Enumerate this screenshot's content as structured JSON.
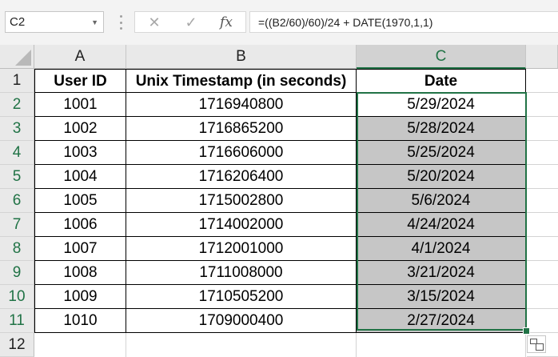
{
  "name_box": {
    "value": "C2"
  },
  "formula_bar": {
    "cancel_glyph": "✕",
    "enter_glyph": "✓",
    "fx_glyph": "fx",
    "formula": "=((B2/60)/60)/24 + DATE(1970,1,1)"
  },
  "columns": [
    "A",
    "B",
    "C"
  ],
  "selected_column": "C",
  "rows": [
    "1",
    "2",
    "3",
    "4",
    "5",
    "6",
    "7",
    "8",
    "9",
    "10",
    "11",
    "12"
  ],
  "table": {
    "headers": [
      "User ID",
      "Unix Timestamp (in seconds)",
      "Date"
    ],
    "data": [
      [
        "1001",
        "1716940800",
        "5/29/2024"
      ],
      [
        "1002",
        "1716865200",
        "5/28/2024"
      ],
      [
        "1003",
        "1716606000",
        "5/25/2024"
      ],
      [
        "1004",
        "1716206400",
        "5/20/2024"
      ],
      [
        "1005",
        "1715002800",
        "5/6/2024"
      ],
      [
        "1006",
        "1714002000",
        "4/24/2024"
      ],
      [
        "1007",
        "1712001000",
        "4/1/2024"
      ],
      [
        "1008",
        "1711008000",
        "3/21/2024"
      ],
      [
        "1009",
        "1710505200",
        "3/15/2024"
      ],
      [
        "1010",
        "1709000400",
        "2/27/2024"
      ]
    ]
  },
  "colors": {
    "accent": "#217346",
    "selection_fill": "#c6c6c6",
    "header_bg": "#e9e9e9"
  },
  "icons": {
    "name_box_dropdown": "chevron-down-icon",
    "cancel": "close-icon",
    "enter": "checkmark-icon",
    "function": "fx-icon",
    "quick_analysis": "quick-analysis-icon"
  }
}
